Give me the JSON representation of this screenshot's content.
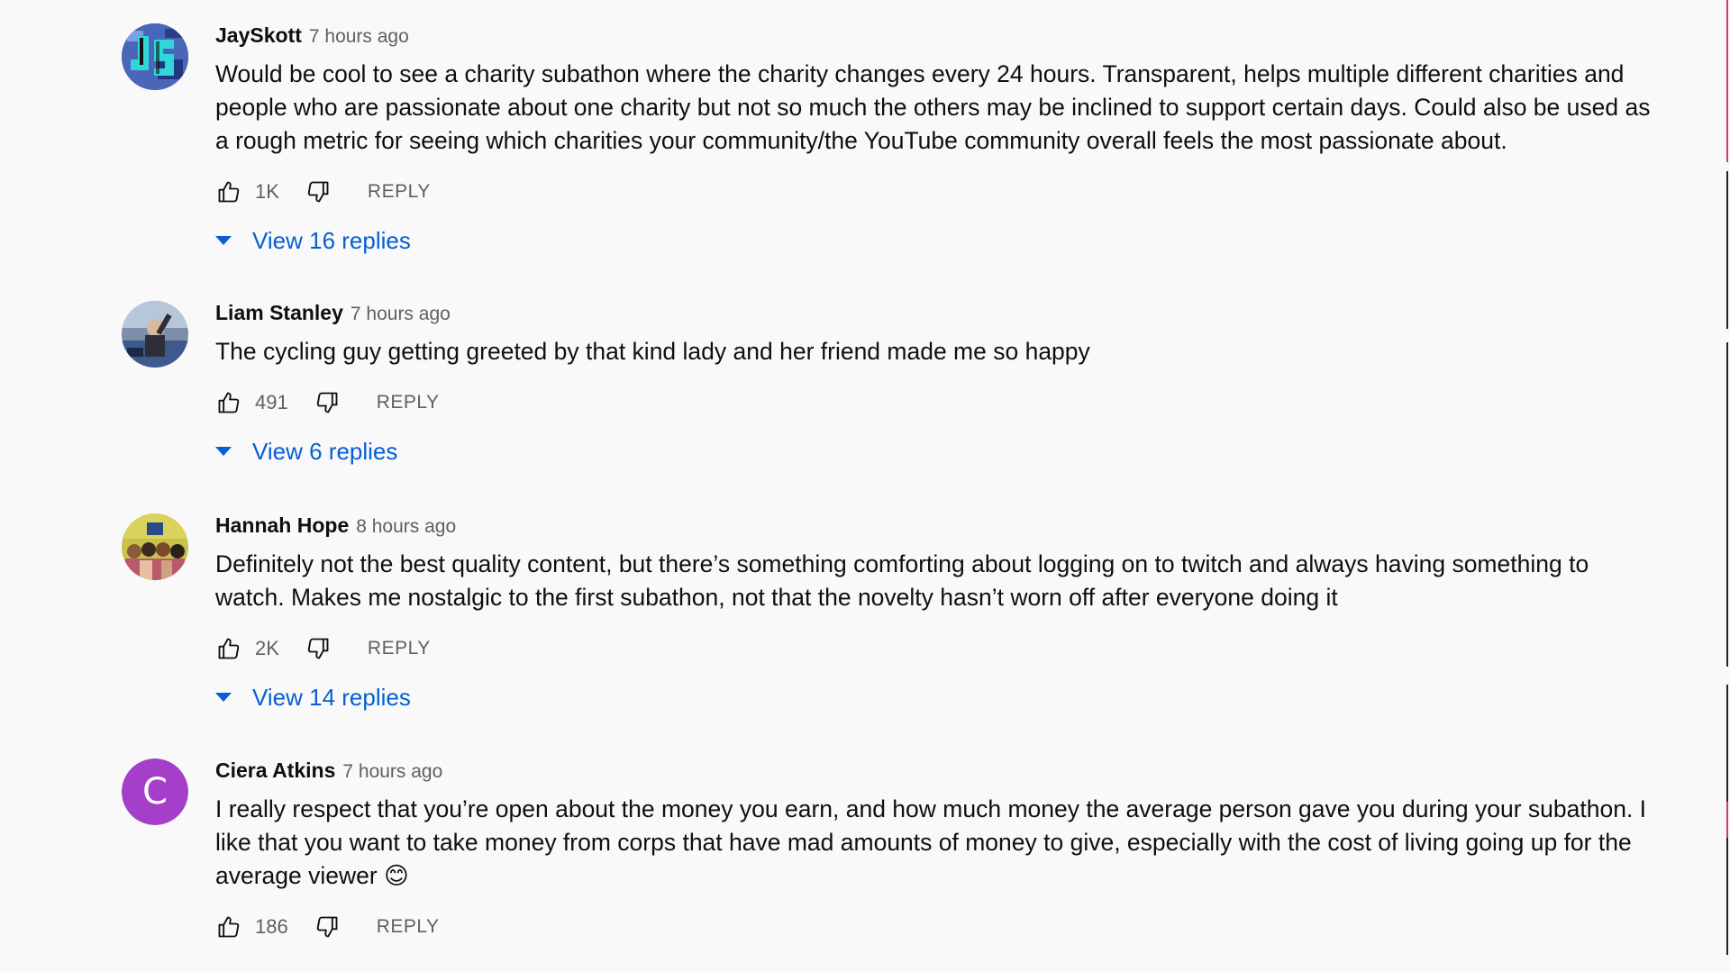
{
  "comments": [
    {
      "author": "JaySkott",
      "time": "7 hours ago",
      "text": "Would be cool to see a charity subathon where the charity changes every 24 hours. Transparent, helps multiple different charities and people who are passionate about one charity but not so much the others may be inclined to support certain days. Could also be used as a rough metric for seeing which charities your community/the YouTube community overall feels the most passionate about.",
      "likes": "1K",
      "reply_label": "REPLY",
      "replies_label": "View 16 replies",
      "avatar": "pixel-art-avatar"
    },
    {
      "author": "Liam Stanley",
      "time": "7 hours ago",
      "text": "The cycling guy getting greeted by that kind lady and her friend made me so happy",
      "likes": "491",
      "reply_label": "REPLY",
      "replies_label": "View 6 replies",
      "avatar": "photo-avatar"
    },
    {
      "author": "Hannah Hope",
      "time": "8 hours ago",
      "text": "Definitely not the best quality content, but there’s something comforting about logging on to twitch and always having something to watch. Makes me nostalgic to the first subathon, not that the novelty hasn’t worn off after everyone doing it",
      "likes": "2K",
      "reply_label": "REPLY",
      "replies_label": "View 14 replies",
      "avatar": "photo-avatar"
    },
    {
      "author": "Ciera Atkins",
      "time": "7 hours ago",
      "text": "I really respect that you’re open about the money you earn, and how much money the average person gave you during your subathon. I like that you want to take money from corps that have mad amounts of money to give, especially with the cost of living going up for the average viewer 😊",
      "likes": "186",
      "reply_label": "REPLY",
      "avatar": "letter-avatar",
      "avatar_letter": "C",
      "avatar_color": "#a53fc9"
    }
  ],
  "colors": {
    "link_blue": "#065fd4",
    "secondary_text": "#606060",
    "background": "#f9f9f9"
  }
}
